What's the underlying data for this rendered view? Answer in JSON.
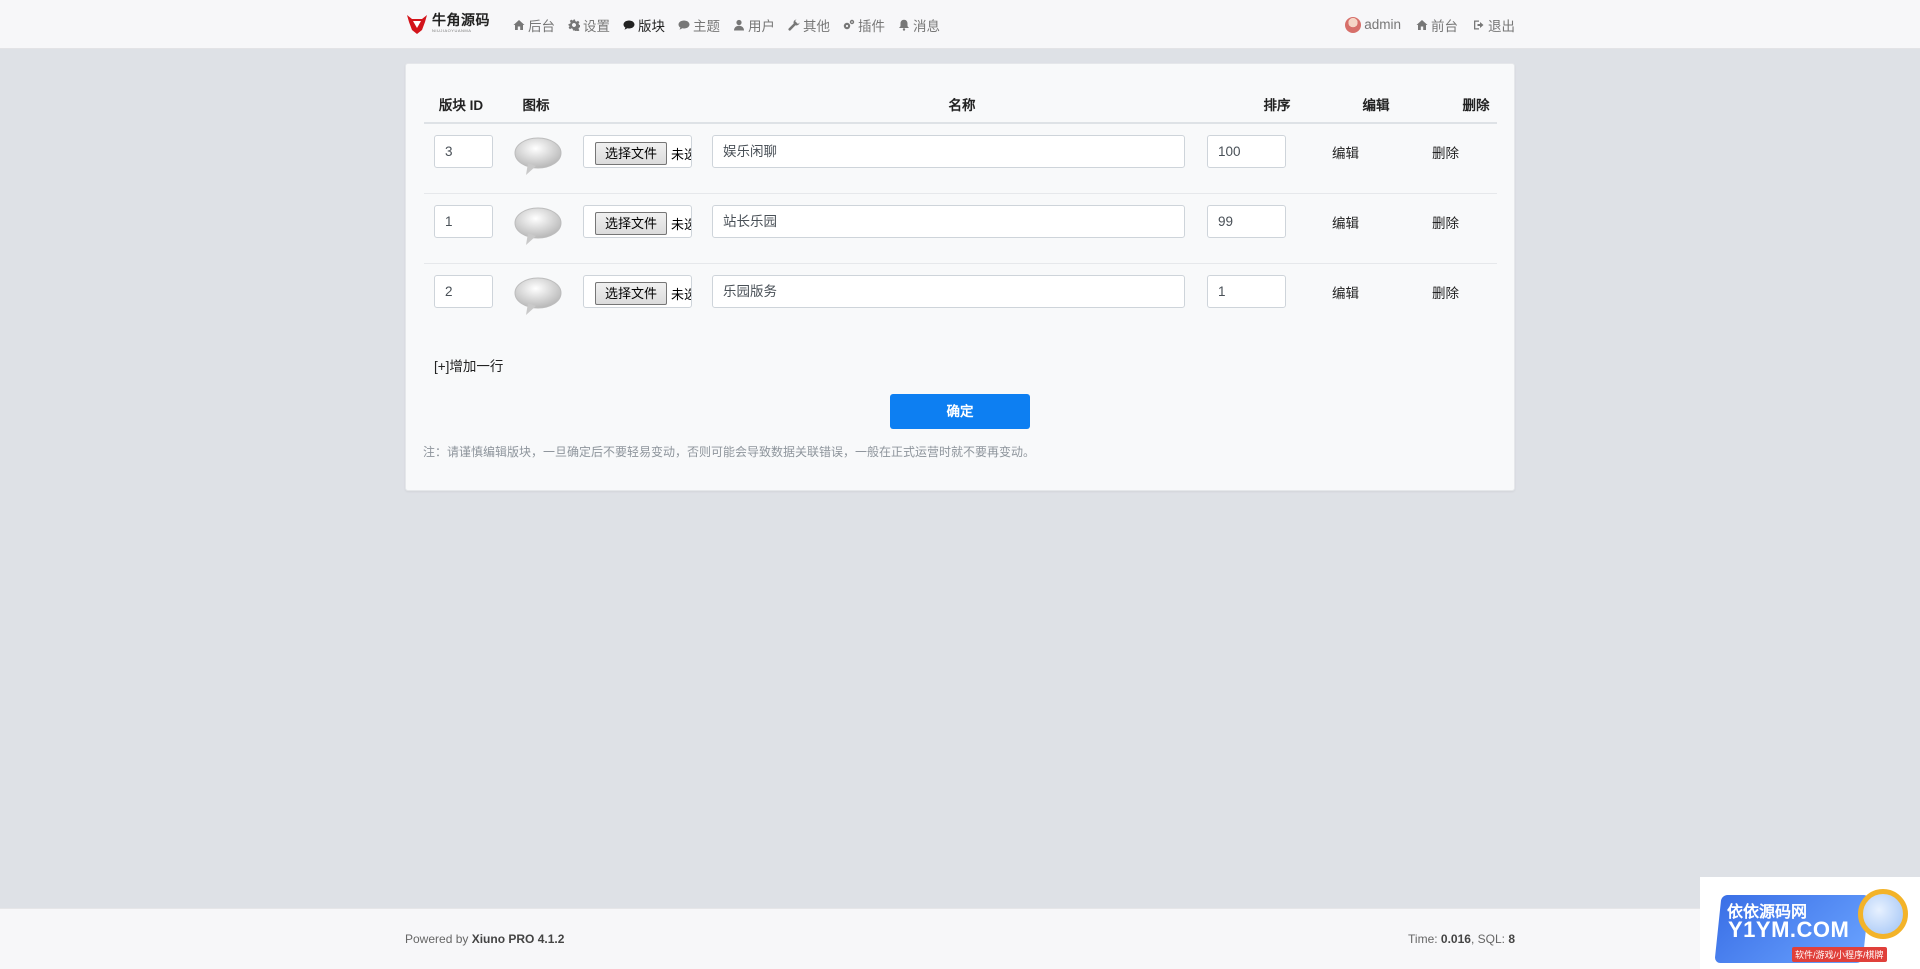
{
  "brand": {
    "name": "牛角源码",
    "tagline": "NIUJIAOYUANMA"
  },
  "nav": {
    "left": [
      {
        "label": "后台",
        "icon": "home-icon"
      },
      {
        "label": "设置",
        "icon": "gear-icon"
      },
      {
        "label": "版块",
        "icon": "comment-icon",
        "active": true
      },
      {
        "label": "主题",
        "icon": "comment-icon"
      },
      {
        "label": "用户",
        "icon": "user-icon"
      },
      {
        "label": "其他",
        "icon": "wrench-icon"
      },
      {
        "label": "插件",
        "icon": "gears-icon"
      },
      {
        "label": "消息",
        "icon": "bell-icon"
      }
    ],
    "right": [
      {
        "label": "admin",
        "icon": "avatar"
      },
      {
        "label": "前台",
        "icon": "home-icon"
      },
      {
        "label": "退出",
        "icon": "sign-out-icon"
      }
    ]
  },
  "table": {
    "headers": {
      "id": "版块 ID",
      "icon": "图标",
      "name": "名称",
      "rank": "排序",
      "edit": "编辑",
      "delete": "删除"
    },
    "rows": [
      {
        "id": "3",
        "name": "娱乐闲聊",
        "rank": "100",
        "file_button": "选择文件",
        "file_status": "未选择任何文件",
        "edit": "编辑",
        "delete": "删除"
      },
      {
        "id": "1",
        "name": "站长乐园",
        "rank": "99",
        "file_button": "选择文件",
        "file_status": "未选择任何文件",
        "edit": "编辑",
        "delete": "删除"
      },
      {
        "id": "2",
        "name": "乐园版务",
        "rank": "1",
        "file_button": "选择文件",
        "file_status": "未选择任何文件",
        "edit": "编辑",
        "delete": "删除"
      }
    ]
  },
  "add_row": "[+]增加一行",
  "confirm": "确定",
  "note": "注：请谨慎编辑版块，一旦确定后不要轻易变动，否则可能会导致数据关联错误，一般在正式运营时就不要再变动。",
  "footer": {
    "powered_prefix": "Powered by ",
    "powered_name": "Xiuno PRO 4.1.2",
    "time_label": "Time: ",
    "time_value": "0.016",
    "sql_label": ", SQL: ",
    "sql_value": "8"
  },
  "watermark": {
    "cn": "依依源码网",
    "en": "Y1YM.COM",
    "sub": "软件/游戏/小程序/棋牌"
  },
  "colors": {
    "accent": "#0d7ff2",
    "background": "#dee1e6"
  }
}
